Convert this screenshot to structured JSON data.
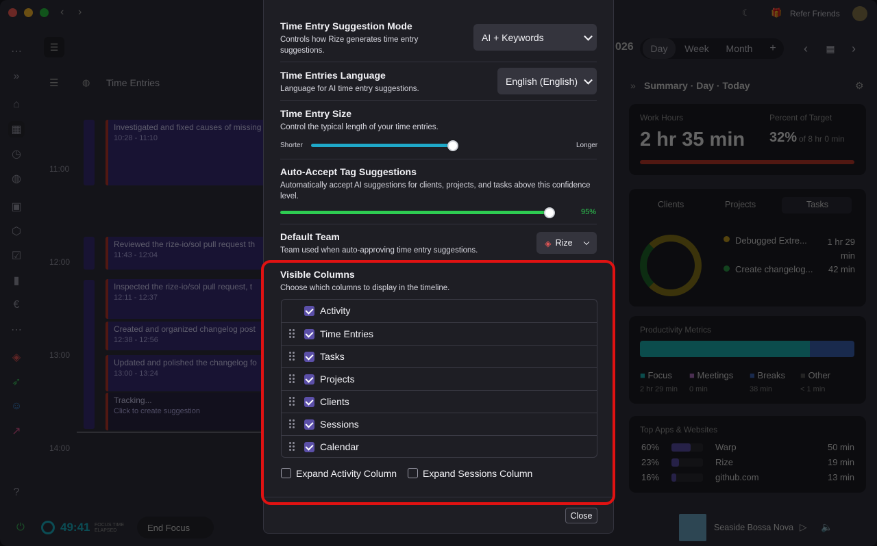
{
  "window": {
    "refer": "Refer Friends",
    "year_fragment": "026"
  },
  "view_tabs": [
    "Day",
    "Week",
    "Month"
  ],
  "timeline": {
    "header": "Time Entries",
    "hours": [
      "11:00",
      "12:00",
      "13:00",
      "14:00"
    ],
    "entries": [
      {
        "title": "Investigated and fixed causes of missing",
        "time": "10:28 - 11:10"
      },
      {
        "title": "Reviewed the rize-io/sol pull request th",
        "time": "11:43 - 12:04"
      },
      {
        "title": "Inspected the rize-io/sol pull request, t",
        "time": "12:11 - 12:37"
      },
      {
        "title": "Created and organized changelog post",
        "time": "12:38 - 12:56"
      },
      {
        "title": "Updated and polished the changelog fo",
        "time": "13:00 - 13:24"
      }
    ],
    "tracking": {
      "title": "Tracking...",
      "sub": "Click to create suggestion"
    }
  },
  "summary": {
    "title": "Summary · Day · Today",
    "work_hours_label": "Work Hours",
    "work_hours": "2 hr 35 min",
    "percent_label": "Percent of Target",
    "percent": "32%",
    "percent_sub": "of 8 hr 0 min",
    "tabs": [
      "Clients",
      "Projects",
      "Tasks"
    ],
    "tasks": [
      {
        "name": "Debugged Extre...",
        "time": "1 hr 29 min"
      },
      {
        "name": "Create changelog...",
        "time": "42 min"
      }
    ],
    "productivity_label": "Productivity Metrics",
    "legend": [
      {
        "name": "Focus",
        "val": "2 hr 29 min"
      },
      {
        "name": "Meetings",
        "val": "0 min"
      },
      {
        "name": "Breaks",
        "val": "38 min"
      },
      {
        "name": "Other",
        "val": "< 1 min"
      }
    ],
    "top_apps_label": "Top Apps & Websites",
    "apps": [
      {
        "pct": "60%",
        "name": "Warp",
        "time": "50 min"
      },
      {
        "pct": "23%",
        "name": "Rize",
        "time": "19 min"
      },
      {
        "pct": "16%",
        "name": "github.com",
        "time": "13 min"
      }
    ]
  },
  "bottom": {
    "timer": "49:41",
    "focus_label": "FOCUS TIME",
    "elapsed_label": "ELAPSED",
    "end_focus": "End Focus",
    "track": "Seaside Bossa Nova"
  },
  "modal": {
    "suggestion_mode": {
      "title": "Time Entry Suggestion Mode",
      "desc": "Controls how Rize generates time entry suggestions.",
      "value": "AI + Keywords"
    },
    "language": {
      "title": "Time Entries Language",
      "desc": "Language for AI time entry suggestions.",
      "value": "English (English)"
    },
    "size": {
      "title": "Time Entry Size",
      "desc": "Control the typical length of your time entries.",
      "min": "Shorter",
      "max": "Longer",
      "level": 0.6
    },
    "auto_accept": {
      "title": "Auto-Accept Tag Suggestions",
      "desc": "Automatically accept AI suggestions for clients, projects, and tasks above this confidence level.",
      "value": "95%",
      "level": 0.95
    },
    "default_team": {
      "title": "Default Team",
      "desc": "Team used when auto-approving time entry suggestions.",
      "value": "Rize"
    },
    "visible_columns": {
      "title": "Visible Columns",
      "desc": "Choose which columns to display in the timeline.",
      "columns": [
        "Activity",
        "Time Entries",
        "Tasks",
        "Projects",
        "Clients",
        "Sessions",
        "Calendar"
      ]
    },
    "expand_activity": "Expand Activity Column",
    "expand_sessions": "Expand Sessions Column",
    "close": "Close"
  },
  "colors": {
    "highlight": "#e01212",
    "accent": "#5b4fa8",
    "slider_blue": "#1fa9c9",
    "slider_green": "#2ecc52"
  }
}
